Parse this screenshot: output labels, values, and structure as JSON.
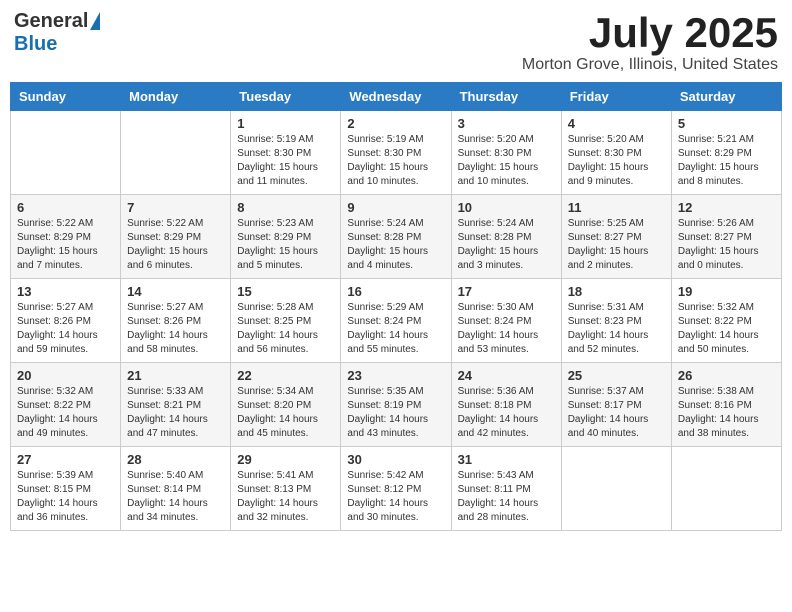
{
  "logo": {
    "general": "General",
    "blue": "Blue"
  },
  "title": "July 2025",
  "subtitle": "Morton Grove, Illinois, United States",
  "days_of_week": [
    "Sunday",
    "Monday",
    "Tuesday",
    "Wednesday",
    "Thursday",
    "Friday",
    "Saturday"
  ],
  "weeks": [
    [
      {
        "day": "",
        "info": ""
      },
      {
        "day": "",
        "info": ""
      },
      {
        "day": "1",
        "info": "Sunrise: 5:19 AM\nSunset: 8:30 PM\nDaylight: 15 hours and 11 minutes."
      },
      {
        "day": "2",
        "info": "Sunrise: 5:19 AM\nSunset: 8:30 PM\nDaylight: 15 hours and 10 minutes."
      },
      {
        "day": "3",
        "info": "Sunrise: 5:20 AM\nSunset: 8:30 PM\nDaylight: 15 hours and 10 minutes."
      },
      {
        "day": "4",
        "info": "Sunrise: 5:20 AM\nSunset: 8:30 PM\nDaylight: 15 hours and 9 minutes."
      },
      {
        "day": "5",
        "info": "Sunrise: 5:21 AM\nSunset: 8:29 PM\nDaylight: 15 hours and 8 minutes."
      }
    ],
    [
      {
        "day": "6",
        "info": "Sunrise: 5:22 AM\nSunset: 8:29 PM\nDaylight: 15 hours and 7 minutes."
      },
      {
        "day": "7",
        "info": "Sunrise: 5:22 AM\nSunset: 8:29 PM\nDaylight: 15 hours and 6 minutes."
      },
      {
        "day": "8",
        "info": "Sunrise: 5:23 AM\nSunset: 8:29 PM\nDaylight: 15 hours and 5 minutes."
      },
      {
        "day": "9",
        "info": "Sunrise: 5:24 AM\nSunset: 8:28 PM\nDaylight: 15 hours and 4 minutes."
      },
      {
        "day": "10",
        "info": "Sunrise: 5:24 AM\nSunset: 8:28 PM\nDaylight: 15 hours and 3 minutes."
      },
      {
        "day": "11",
        "info": "Sunrise: 5:25 AM\nSunset: 8:27 PM\nDaylight: 15 hours and 2 minutes."
      },
      {
        "day": "12",
        "info": "Sunrise: 5:26 AM\nSunset: 8:27 PM\nDaylight: 15 hours and 0 minutes."
      }
    ],
    [
      {
        "day": "13",
        "info": "Sunrise: 5:27 AM\nSunset: 8:26 PM\nDaylight: 14 hours and 59 minutes."
      },
      {
        "day": "14",
        "info": "Sunrise: 5:27 AM\nSunset: 8:26 PM\nDaylight: 14 hours and 58 minutes."
      },
      {
        "day": "15",
        "info": "Sunrise: 5:28 AM\nSunset: 8:25 PM\nDaylight: 14 hours and 56 minutes."
      },
      {
        "day": "16",
        "info": "Sunrise: 5:29 AM\nSunset: 8:24 PM\nDaylight: 14 hours and 55 minutes."
      },
      {
        "day": "17",
        "info": "Sunrise: 5:30 AM\nSunset: 8:24 PM\nDaylight: 14 hours and 53 minutes."
      },
      {
        "day": "18",
        "info": "Sunrise: 5:31 AM\nSunset: 8:23 PM\nDaylight: 14 hours and 52 minutes."
      },
      {
        "day": "19",
        "info": "Sunrise: 5:32 AM\nSunset: 8:22 PM\nDaylight: 14 hours and 50 minutes."
      }
    ],
    [
      {
        "day": "20",
        "info": "Sunrise: 5:32 AM\nSunset: 8:22 PM\nDaylight: 14 hours and 49 minutes."
      },
      {
        "day": "21",
        "info": "Sunrise: 5:33 AM\nSunset: 8:21 PM\nDaylight: 14 hours and 47 minutes."
      },
      {
        "day": "22",
        "info": "Sunrise: 5:34 AM\nSunset: 8:20 PM\nDaylight: 14 hours and 45 minutes."
      },
      {
        "day": "23",
        "info": "Sunrise: 5:35 AM\nSunset: 8:19 PM\nDaylight: 14 hours and 43 minutes."
      },
      {
        "day": "24",
        "info": "Sunrise: 5:36 AM\nSunset: 8:18 PM\nDaylight: 14 hours and 42 minutes."
      },
      {
        "day": "25",
        "info": "Sunrise: 5:37 AM\nSunset: 8:17 PM\nDaylight: 14 hours and 40 minutes."
      },
      {
        "day": "26",
        "info": "Sunrise: 5:38 AM\nSunset: 8:16 PM\nDaylight: 14 hours and 38 minutes."
      }
    ],
    [
      {
        "day": "27",
        "info": "Sunrise: 5:39 AM\nSunset: 8:15 PM\nDaylight: 14 hours and 36 minutes."
      },
      {
        "day": "28",
        "info": "Sunrise: 5:40 AM\nSunset: 8:14 PM\nDaylight: 14 hours and 34 minutes."
      },
      {
        "day": "29",
        "info": "Sunrise: 5:41 AM\nSunset: 8:13 PM\nDaylight: 14 hours and 32 minutes."
      },
      {
        "day": "30",
        "info": "Sunrise: 5:42 AM\nSunset: 8:12 PM\nDaylight: 14 hours and 30 minutes."
      },
      {
        "day": "31",
        "info": "Sunrise: 5:43 AM\nSunset: 8:11 PM\nDaylight: 14 hours and 28 minutes."
      },
      {
        "day": "",
        "info": ""
      },
      {
        "day": "",
        "info": ""
      }
    ]
  ]
}
